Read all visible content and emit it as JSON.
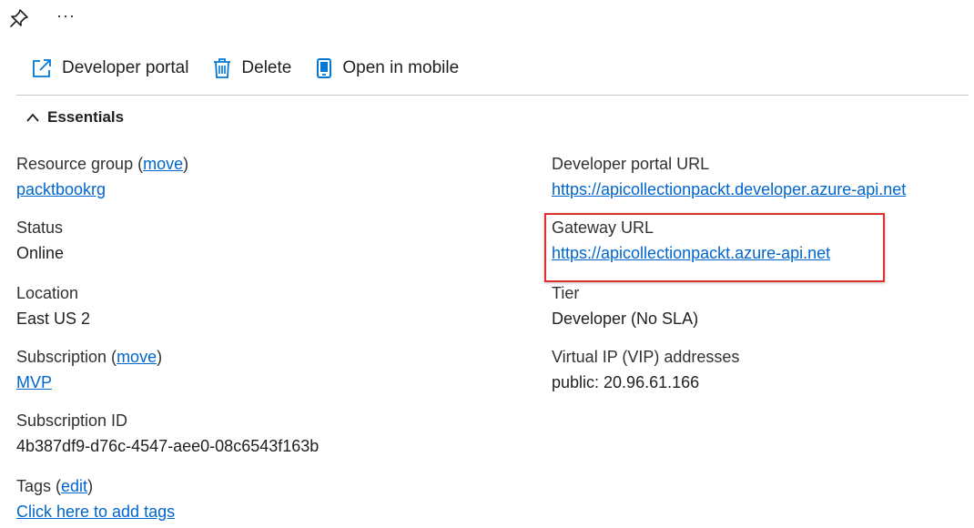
{
  "toolbar": {
    "pin_icon": "pin-icon",
    "more_label": "···"
  },
  "commands": {
    "developer_portal": "Developer portal",
    "delete": "Delete",
    "open_in_mobile": "Open in mobile"
  },
  "essentials": {
    "title": "Essentials"
  },
  "left": {
    "resource_group": {
      "label": "Resource group (",
      "action": "move",
      "label_end": ")",
      "value": "packtbookrg"
    },
    "status": {
      "label": "Status",
      "value": "Online"
    },
    "location": {
      "label": "Location",
      "value": "East US 2"
    },
    "subscription": {
      "label": "Subscription (",
      "action": "move",
      "label_end": ")",
      "value": "MVP"
    },
    "subscription_id": {
      "label": "Subscription ID",
      "value": "4b387df9-d76c-4547-aee0-08c6543f163b"
    },
    "tags": {
      "label": "Tags (",
      "action": "edit",
      "label_end": ")",
      "value": "Click here to add tags"
    }
  },
  "right": {
    "developer_portal_url": {
      "label": "Developer portal URL",
      "value": "https://apicollectionpackt.developer.azure-api.net"
    },
    "gateway_url": {
      "label": "Gateway URL",
      "value": "https://apicollectionpackt.azure-api.net"
    },
    "tier": {
      "label": "Tier",
      "value": "Developer (No SLA)"
    },
    "vip": {
      "label": "Virtual IP (VIP) addresses",
      "value": "public: 20.96.61.166"
    }
  },
  "colors": {
    "link": "#0066cc",
    "accent": "#0078d4",
    "highlight_border": "#e02f2f"
  }
}
